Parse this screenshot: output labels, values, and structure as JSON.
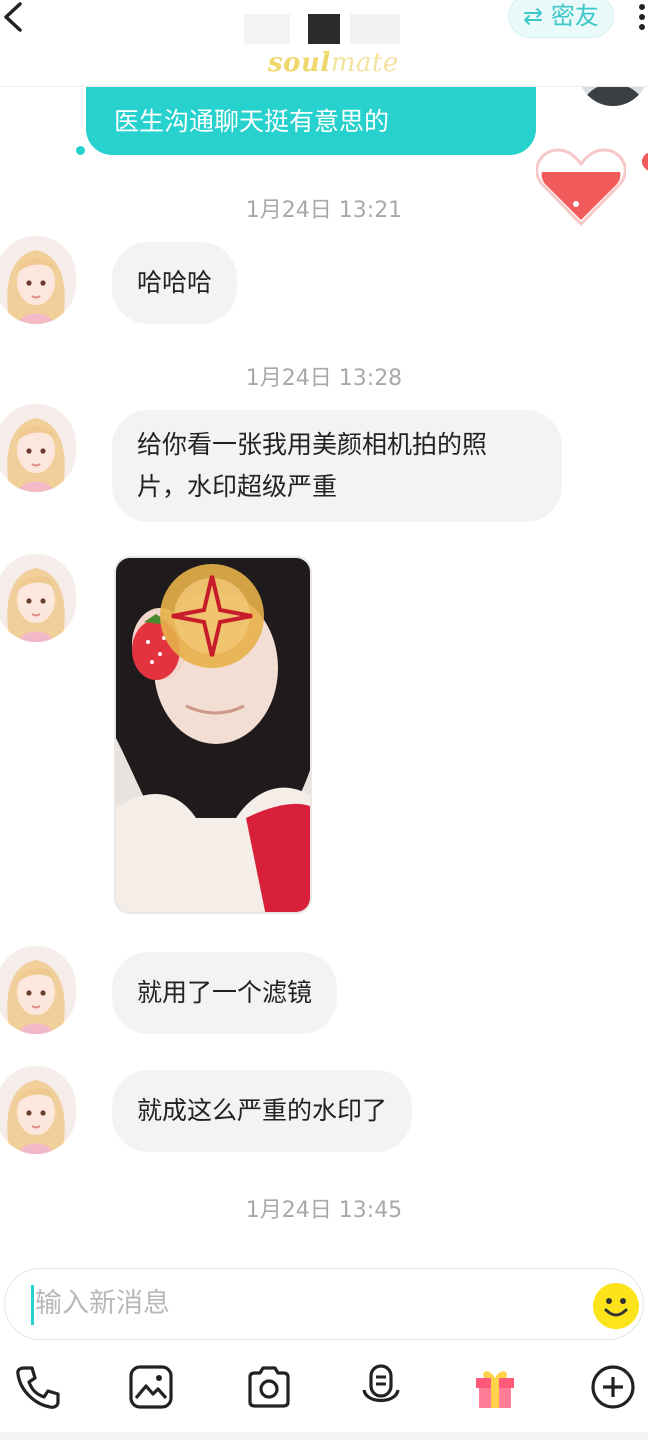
{
  "header": {
    "switch_label": "⇄ 密友",
    "brand_a": "soul",
    "brand_b": "mate"
  },
  "outgoing": {
    "text": "医生沟通聊天挺有意思的"
  },
  "messages": {
    "ts1": "1月24日 13:21",
    "m1": "哈哈哈",
    "ts2": "1月24日 13:28",
    "m2_line1": "给你看一张我用美颜相机拍的照",
    "m2_line2": "片，水印超级严重",
    "m3": "就用了一个滤镜",
    "m4": "就成这么严重的水印了",
    "ts3": "1月24日 13:45"
  },
  "input": {
    "placeholder": "输入新消息"
  },
  "toolbar": {
    "icons": [
      "phone-icon",
      "image-icon",
      "camera-icon",
      "voice-icon",
      "gift-icon",
      "plus-icon"
    ]
  },
  "colors": {
    "accent": "#27d1cd",
    "bubble_in": "#f3f3f3",
    "timestamp": "#a9a9a9",
    "emoji": "#fce31a",
    "heart": "#f25b5b"
  }
}
